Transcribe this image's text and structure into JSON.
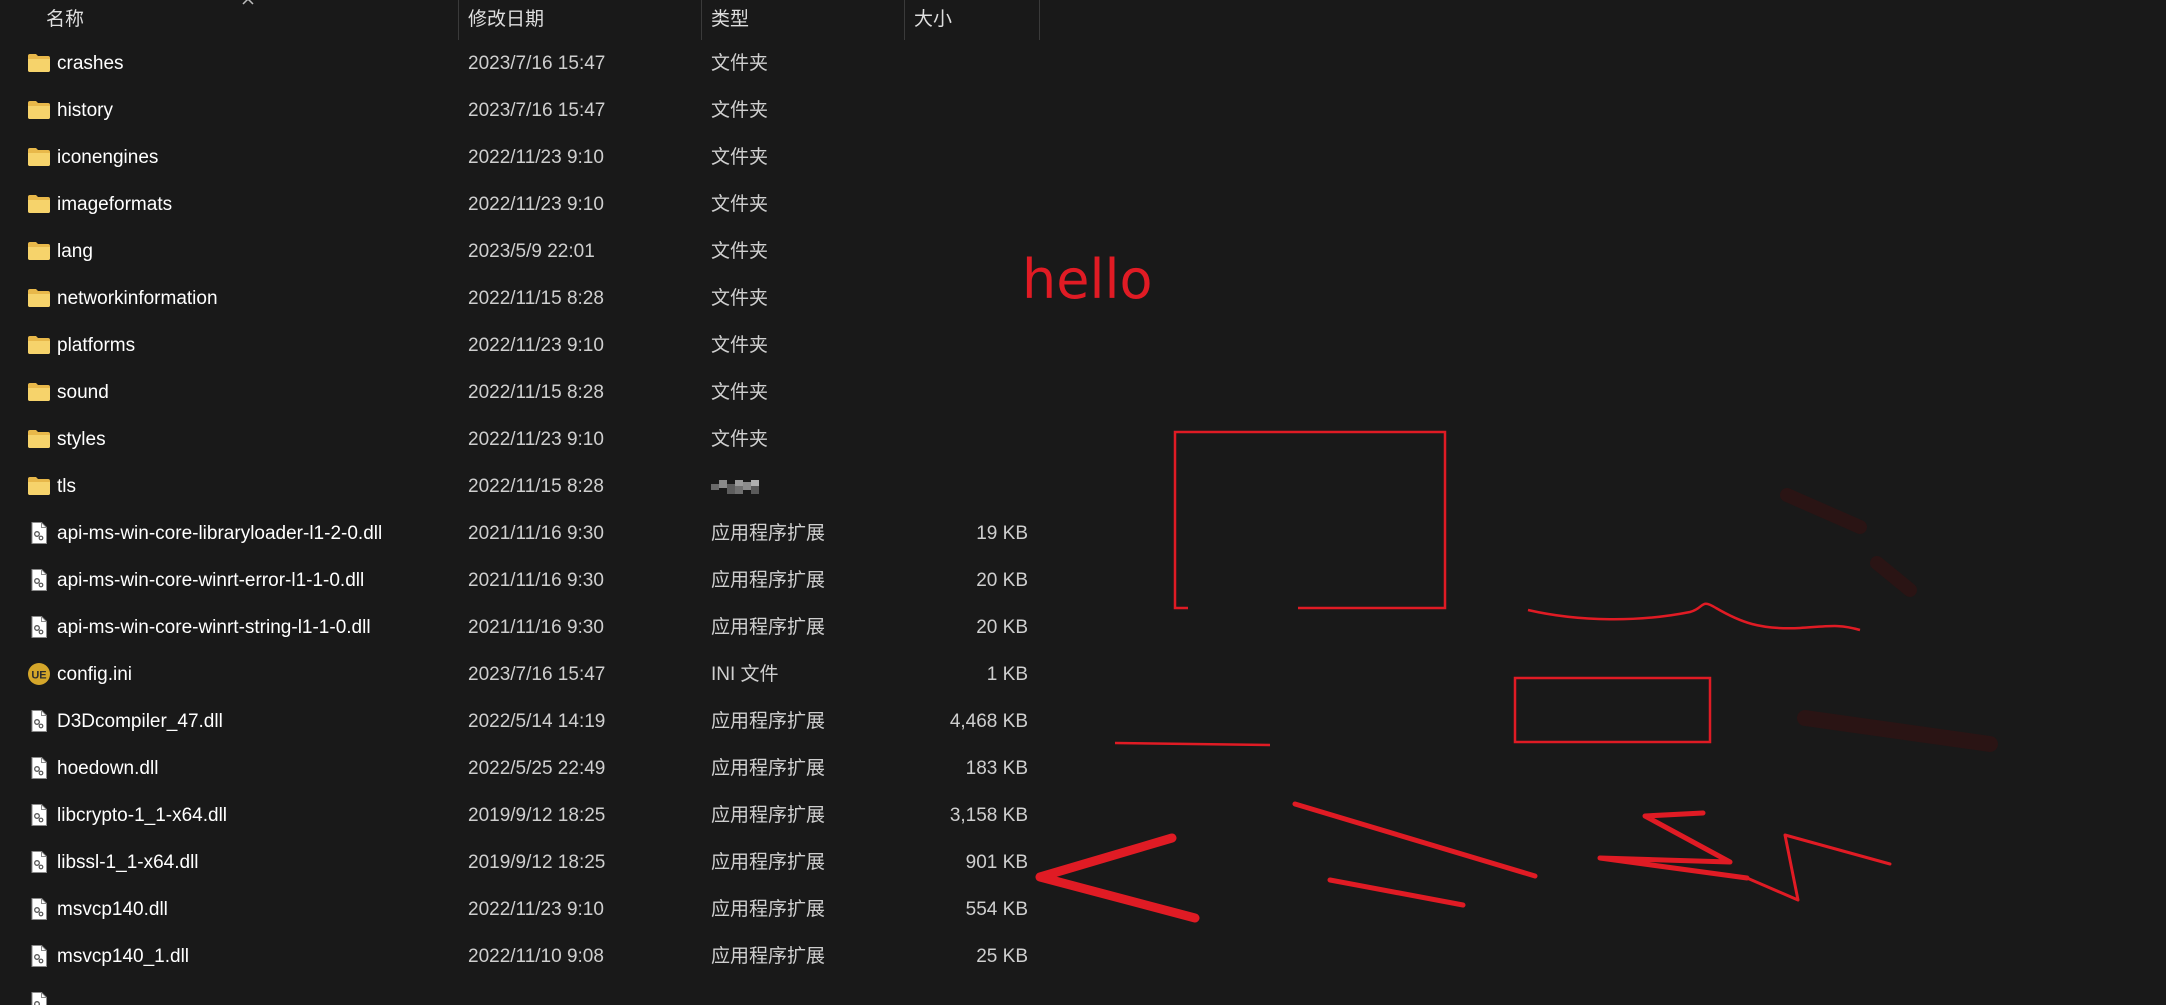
{
  "columns": {
    "name": "名称",
    "date": "修改日期",
    "type": "类型",
    "size": "大小"
  },
  "files": [
    {
      "name": "crashes",
      "date": "2023/7/16 15:47",
      "type": "文件夹",
      "size": "",
      "icon": "folder-icon"
    },
    {
      "name": "history",
      "date": "2023/7/16 15:47",
      "type": "文件夹",
      "size": "",
      "icon": "folder-icon"
    },
    {
      "name": "iconengines",
      "date": "2022/11/23 9:10",
      "type": "文件夹",
      "size": "",
      "icon": "folder-icon"
    },
    {
      "name": "imageformats",
      "date": "2022/11/23 9:10",
      "type": "文件夹",
      "size": "",
      "icon": "folder-icon"
    },
    {
      "name": "lang",
      "date": "2023/5/9 22:01",
      "type": "文件夹",
      "size": "",
      "icon": "folder-icon"
    },
    {
      "name": "networkinformation",
      "date": "2022/11/15 8:28",
      "type": "文件夹",
      "size": "",
      "icon": "folder-icon"
    },
    {
      "name": "platforms",
      "date": "2022/11/23 9:10",
      "type": "文件夹",
      "size": "",
      "icon": "folder-icon"
    },
    {
      "name": "sound",
      "date": "2022/11/15 8:28",
      "type": "文件夹",
      "size": "",
      "icon": "folder-icon"
    },
    {
      "name": "styles",
      "date": "2022/11/23 9:10",
      "type": "文件夹",
      "size": "",
      "icon": "folder-icon"
    },
    {
      "name": "tls",
      "date": "2022/11/15 8:28",
      "type": "",
      "size": "",
      "icon": "folder-icon"
    },
    {
      "name": "api-ms-win-core-libraryloader-l1-2-0.dll",
      "date": "2021/11/16 9:30",
      "type": "应用程序扩展",
      "size": "19 KB",
      "icon": "dll-file-icon"
    },
    {
      "name": "api-ms-win-core-winrt-error-l1-1-0.dll",
      "date": "2021/11/16 9:30",
      "type": "应用程序扩展",
      "size": "20 KB",
      "icon": "dll-file-icon"
    },
    {
      "name": "api-ms-win-core-winrt-string-l1-1-0.dll",
      "date": "2021/11/16 9:30",
      "type": "应用程序扩展",
      "size": "20 KB",
      "icon": "dll-file-icon"
    },
    {
      "name": "config.ini",
      "date": "2023/7/16 15:47",
      "type": "INI 文件",
      "size": "1 KB",
      "icon": "ini-file-icon"
    },
    {
      "name": "D3Dcompiler_47.dll",
      "date": "2022/5/14 14:19",
      "type": "应用程序扩展",
      "size": "4,468 KB",
      "icon": "dll-file-icon"
    },
    {
      "name": "hoedown.dll",
      "date": "2022/5/25 22:49",
      "type": "应用程序扩展",
      "size": "183 KB",
      "icon": "dll-file-icon"
    },
    {
      "name": "libcrypto-1_1-x64.dll",
      "date": "2019/9/12 18:25",
      "type": "应用程序扩展",
      "size": "3,158 KB",
      "icon": "dll-file-icon"
    },
    {
      "name": "libssl-1_1-x64.dll",
      "date": "2019/9/12 18:25",
      "type": "应用程序扩展",
      "size": "901 KB",
      "icon": "dll-file-icon"
    },
    {
      "name": "msvcp140.dll",
      "date": "2022/11/23 9:10",
      "type": "应用程序扩展",
      "size": "554 KB",
      "icon": "dll-file-icon"
    },
    {
      "name": "msvcp140_1.dll",
      "date": "2022/11/10 9:08",
      "type": "应用程序扩展",
      "size": "25 KB",
      "icon": "dll-file-icon"
    }
  ],
  "annotation": {
    "text": "hello",
    "color": "#e01b24"
  },
  "colors": {
    "background": "#191919",
    "folder": "#f2c94c",
    "annotation": "#e01b24"
  }
}
